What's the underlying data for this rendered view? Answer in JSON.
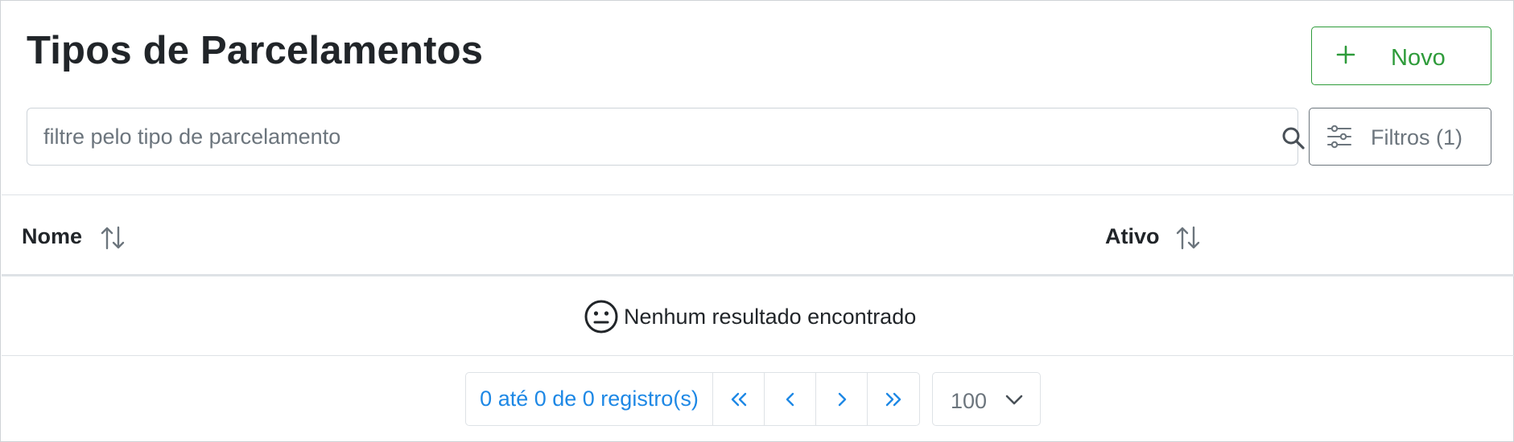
{
  "page": {
    "title": "Tipos de Parcelamentos"
  },
  "toolbar": {
    "new_label": "Novo",
    "filters_label": "Filtros (1)"
  },
  "search": {
    "placeholder": "filtre pelo tipo de parcelamento",
    "value": ""
  },
  "table": {
    "columns": [
      {
        "label": "Nome",
        "sortable": true
      },
      {
        "label": "Ativo",
        "sortable": true
      }
    ],
    "rows": [],
    "empty_message": "Nenhum resultado encontrado"
  },
  "pagination": {
    "info": "0 até 0 de 0 registro(s)",
    "buttons": [
      "first-page-icon",
      "previous-page-icon",
      "next-page-icon",
      "last-page-icon"
    ],
    "page_size": "100"
  },
  "colors": {
    "success": "#2e9b3a",
    "primary": "#1e88e5",
    "secondary": "#6c757d",
    "border": "#dee2e6"
  }
}
